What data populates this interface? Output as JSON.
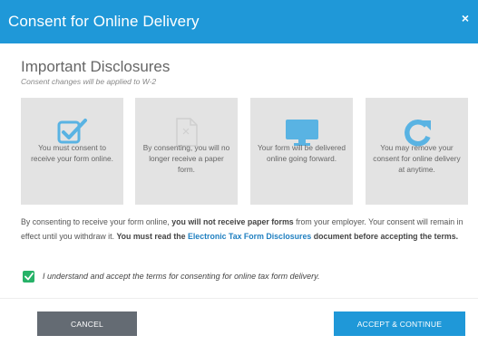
{
  "dialog": {
    "title": "Consent for Online Delivery",
    "close_label": "×",
    "accent_color": "#1f98d8"
  },
  "disclosures": {
    "title": "Important Disclosures",
    "subtitle": "Consent changes will be applied to W-2",
    "cards": [
      {
        "icon": "checkbox-checked-icon",
        "text": "You must consent to receive your form online."
      },
      {
        "icon": "paper-document-icon",
        "text": "By consenting, you will no longer receive a paper form."
      },
      {
        "icon": "monitor-icon",
        "text": "Your form will be delivered online going forward."
      },
      {
        "icon": "refresh-icon",
        "text": "You may remove your consent for online delivery at anytime."
      }
    ]
  },
  "terms": {
    "part1": "By consenting to receive your form online, ",
    "bold1": "you will not receive paper forms",
    "part2": " from your employer. Your consent will remain in effect until you withdraw it. ",
    "bold2": "You must read the ",
    "link": "Electronic Tax Form Disclosures",
    "bold3": " document before accepting the terms."
  },
  "agreement": {
    "checked": true,
    "label": "I understand and accept the terms for consenting for online tax form delivery."
  },
  "footer": {
    "cancel_label": "CANCEL",
    "accept_label": "ACCEPT & CONTINUE"
  }
}
